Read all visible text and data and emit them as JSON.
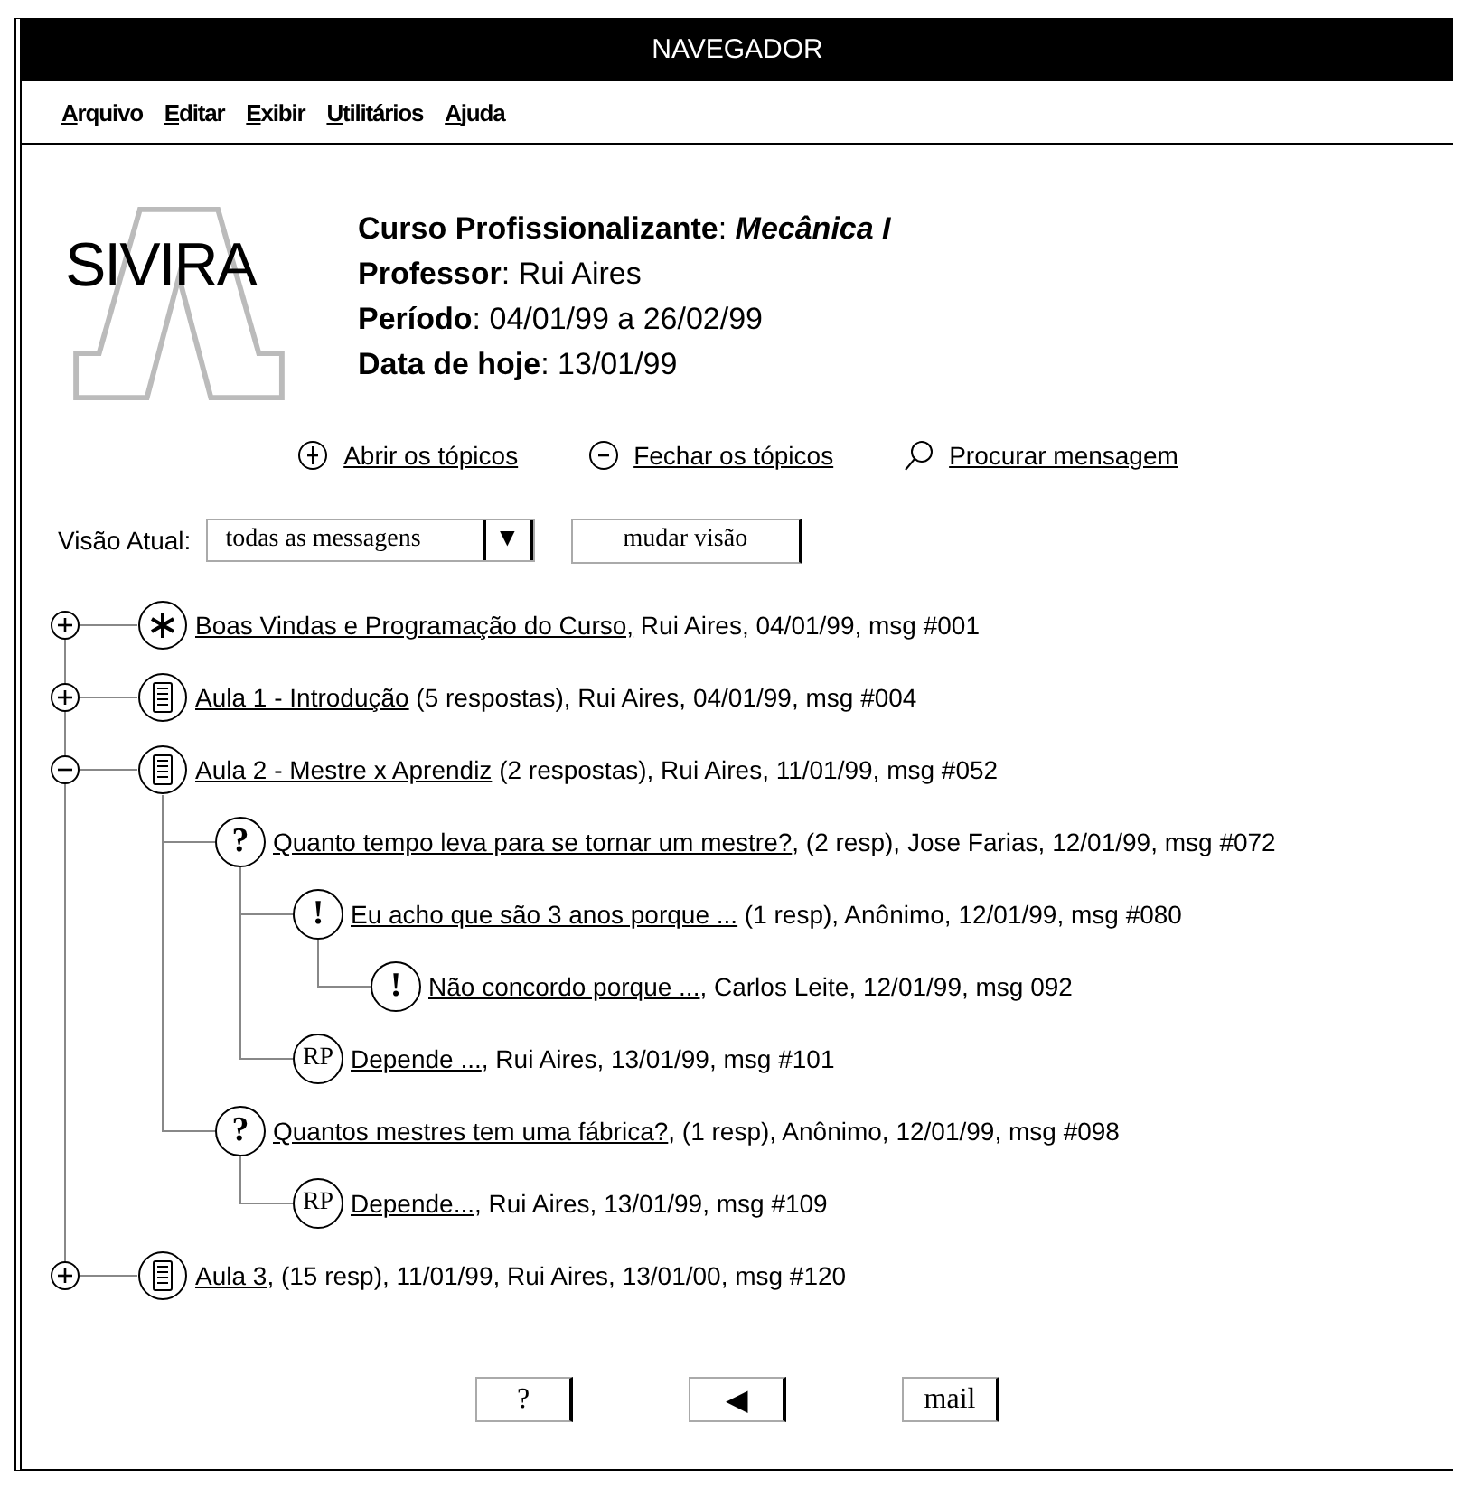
{
  "window": {
    "title": "NAVEGADOR"
  },
  "menu": [
    "Arquivo",
    "Editar",
    "Exibir",
    "Utilitários",
    "Ajuda"
  ],
  "logo": {
    "text": "SIVIRA"
  },
  "course_info": [
    "**Curso Profissionalizante**: *Mecânica I*",
    "**Professor**: Rui Aires",
    "**Período**: 04/01/99 a 26/02/99",
    "**Data de hoje**: 13/01/99"
  ],
  "actions": [
    {
      "kind": "expand",
      "label": "Abrir os tópicos"
    },
    {
      "kind": "collapse",
      "label": "Fechar os tópicos"
    },
    {
      "kind": "search",
      "label": "Procurar mensagem"
    }
  ],
  "view": {
    "label": "Visão Atual:",
    "value": "todas as messagens",
    "arrow": "▼",
    "button": "mudar visão"
  },
  "tree": [
    {
      "kind": "asterisk",
      "title": "Boas Vindas e Programação do Curso,",
      "details": " Rui Aires, 04/01/99, msg #001",
      "expanded": false
    },
    {
      "kind": "document",
      "title": "Aula 1 - Introdução",
      "details": " (5 respostas), Rui Aires, 04/01/99, msg #004",
      "expanded": false
    },
    {
      "kind": "document",
      "title": "Aula 2 - Mestre x Aprendiz",
      "details": " (2 respostas), Rui Aires, 11/01/99, msg #052",
      "expanded": true,
      "children": [
        {
          "kind": "glyph",
          "glyph": "?",
          "title": "Quanto tempo leva para se tornar um mestre?",
          "details": ", (2 resp), Jose Farias, 12/01/99, msg #072",
          "children": [
            {
              "kind": "glyph",
              "glyph": "!",
              "title": "Eu acho que são 3 anos porque ...",
              "details": " (1 resp), Anônimo, 12/01/99, msg #080",
              "children": [
                {
                  "kind": "glyph",
                  "glyph": "!",
                  "title": "Não concordo porque ...",
                  "details": ", Carlos Leite, 12/01/99, msg 092"
                }
              ]
            },
            {
              "kind": "glyph",
              "glyph": "RP",
              "title": "Depende ...",
              "details": ", Rui Aires, 13/01/99, msg #101"
            }
          ]
        },
        {
          "kind": "glyph",
          "glyph": "?",
          "title": "Quantos mestres tem uma fábrica?",
          "details": ", (1 resp), Anônimo, 12/01/99, msg #098",
          "children": [
            {
              "kind": "glyph",
              "glyph": "RP",
              "title": "Depende...",
              "details": ", Rui Aires, 13/01/99, msg #109"
            }
          ]
        }
      ]
    },
    {
      "kind": "document",
      "title": "Aula 3",
      "details": ", (15 resp), 11/01/99, Rui Aires, 13/01/00, msg #120",
      "expanded": false
    }
  ],
  "buttons": [
    "?",
    "◀",
    "mail"
  ]
}
